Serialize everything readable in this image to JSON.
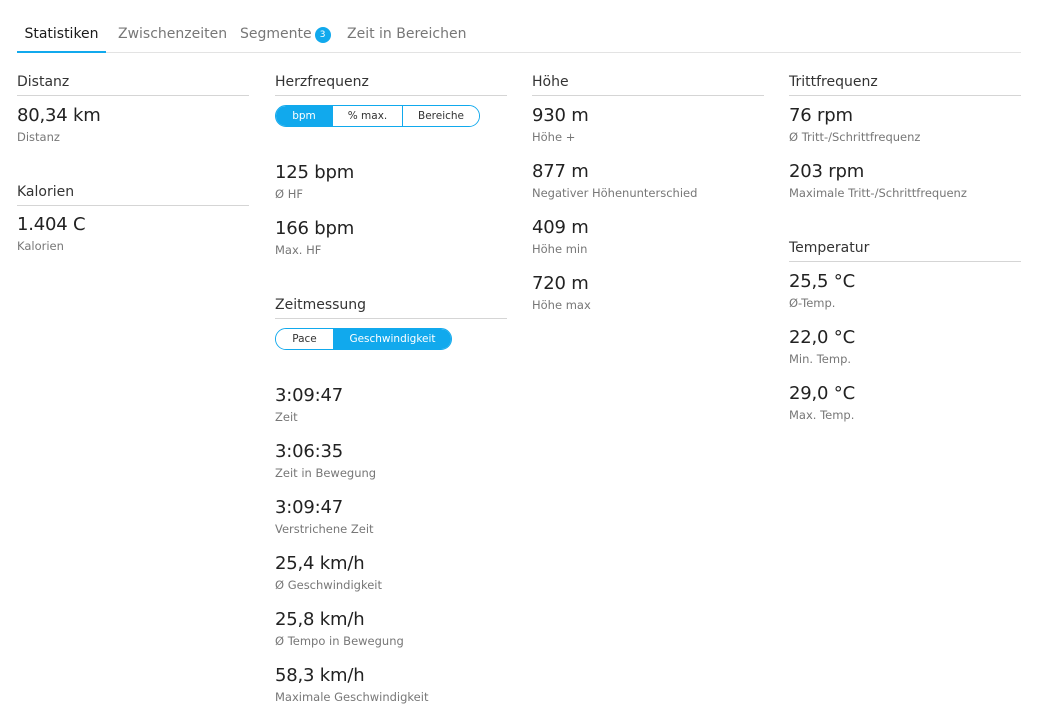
{
  "tabs": [
    {
      "label": "Statistiken",
      "active": true
    },
    {
      "label": "Zwischenzeiten",
      "active": false
    },
    {
      "label": "Segmente",
      "badge": "3",
      "active": false
    },
    {
      "label": "Zeit in Bereichen",
      "active": false
    }
  ],
  "accent_color": "#11a9ed",
  "distance": {
    "title": "Distanz",
    "value": "80,34 km",
    "label": "Distanz"
  },
  "calories": {
    "title": "Kalorien",
    "value": "1.404 C",
    "label": "Kalorien"
  },
  "heart_rate": {
    "title": "Herzfrequenz",
    "toggle": [
      "bpm",
      "% max.",
      "Bereiche"
    ],
    "toggle_selected": "bpm",
    "stats": [
      {
        "value": "125 bpm",
        "label": "Ø HF"
      },
      {
        "value": "166 bpm",
        "label": "Max. HF"
      }
    ]
  },
  "timing": {
    "title": "Zeitmessung",
    "toggle": [
      "Pace",
      "Geschwindigkeit"
    ],
    "toggle_selected": "Geschwindigkeit",
    "stats": [
      {
        "value": "3:09:47",
        "label": "Zeit"
      },
      {
        "value": "3:06:35",
        "label": "Zeit in Bewegung"
      },
      {
        "value": "3:09:47",
        "label": "Verstrichene Zeit"
      },
      {
        "value": "25,4 km/h",
        "label": "Ø Geschwindigkeit"
      },
      {
        "value": "25,8 km/h",
        "label": "Ø Tempo in Bewegung"
      },
      {
        "value": "58,3 km/h",
        "label": "Maximale Geschwindigkeit"
      }
    ]
  },
  "elevation": {
    "title": "Höhe",
    "stats": [
      {
        "value": "930 m",
        "label": "Höhe +"
      },
      {
        "value": "877 m",
        "label": "Negativer Höhenunterschied"
      },
      {
        "value": "409 m",
        "label": "Höhe min"
      },
      {
        "value": "720 m",
        "label": "Höhe max"
      }
    ]
  },
  "cadence": {
    "title": "Trittfrequenz",
    "stats": [
      {
        "value": "76 rpm",
        "label": "Ø Tritt-/Schrittfrequenz"
      },
      {
        "value": "203 rpm",
        "label": "Maximale Tritt-/Schrittfrequenz"
      }
    ]
  },
  "temperature": {
    "title": "Temperatur",
    "stats": [
      {
        "value": "25,5 °C",
        "label": "Ø-Temp."
      },
      {
        "value": "22,0 °C",
        "label": "Min. Temp."
      },
      {
        "value": "29,0 °C",
        "label": "Max. Temp."
      }
    ]
  }
}
